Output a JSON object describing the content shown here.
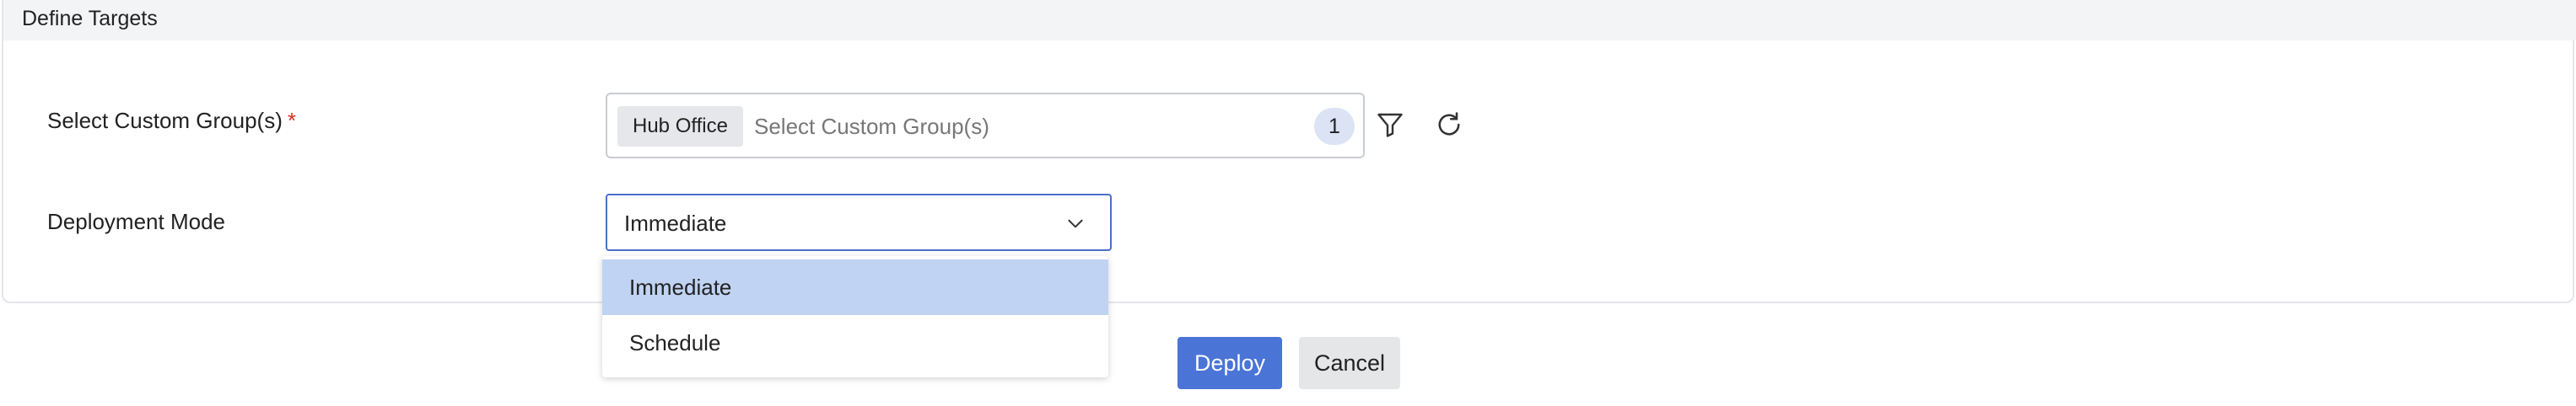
{
  "panel": {
    "title": "Define Targets"
  },
  "custom_group": {
    "label": "Select Custom Group(s)",
    "required_mark": "*",
    "chip": "Hub Office",
    "placeholder": "Select Custom Group(s)",
    "count": "1",
    "filter_icon": "filter-icon",
    "refresh_icon": "refresh-icon"
  },
  "deployment_mode": {
    "label": "Deployment Mode",
    "selected_value": "Immediate",
    "chevron_icon": "chevron-down-icon",
    "options": [
      {
        "label": "Immediate",
        "selected": true
      },
      {
        "label": "Schedule",
        "selected": false
      }
    ]
  },
  "actions": {
    "deploy_label": "Deploy",
    "cancel_label": "Cancel"
  },
  "colors": {
    "accent": "#4a74d6",
    "selected_option_bg": "#c0d3f3",
    "required": "#d93025"
  }
}
